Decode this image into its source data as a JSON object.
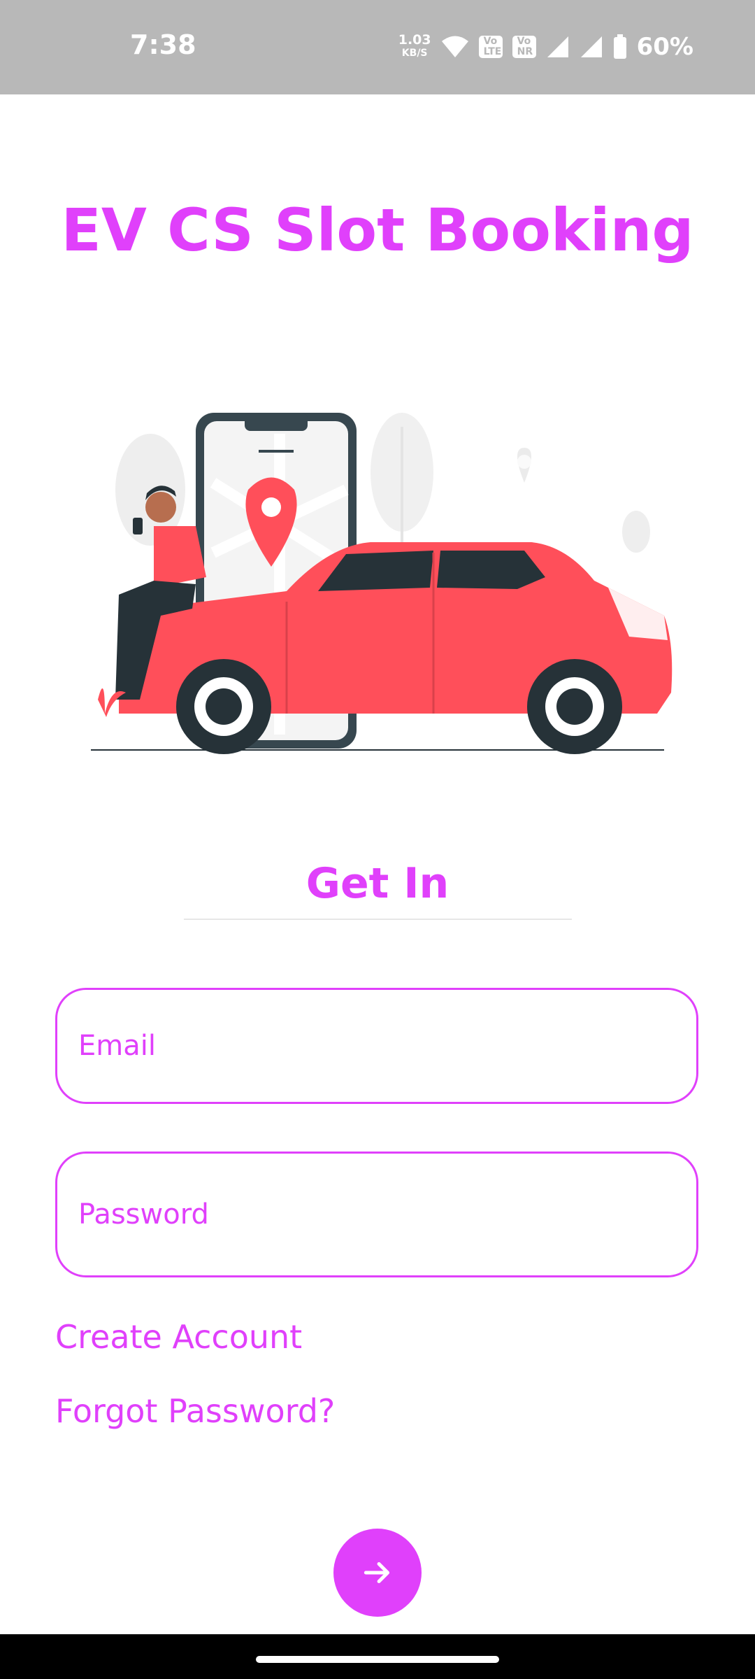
{
  "status_bar": {
    "time": "7:38",
    "net_speed_value": "1.03",
    "net_speed_unit": "KB/S",
    "sim1": {
      "top": "Vo",
      "bottom": "LTE",
      "slot": "2"
    },
    "sim2": {
      "top": "Vo",
      "bottom": "NR",
      "slot": "1"
    },
    "battery": "60%",
    "icons": [
      "wifi-icon",
      "signal-icon",
      "signal-icon",
      "battery-icon"
    ]
  },
  "app": {
    "title": "EV CS Slot Booking",
    "heading": "Get In"
  },
  "form": {
    "email_placeholder": "Email",
    "email_value": "",
    "password_placeholder": "Password",
    "password_value": ""
  },
  "links": {
    "create_account": "Create Account",
    "forgot_password": "Forgot Password?"
  },
  "fab": {
    "icon": "arrow-right-icon"
  },
  "colors": {
    "accent": "#e040fb",
    "car": "#ff4f5a",
    "dark": "#263238",
    "status_bar": "#b8b8b8"
  }
}
